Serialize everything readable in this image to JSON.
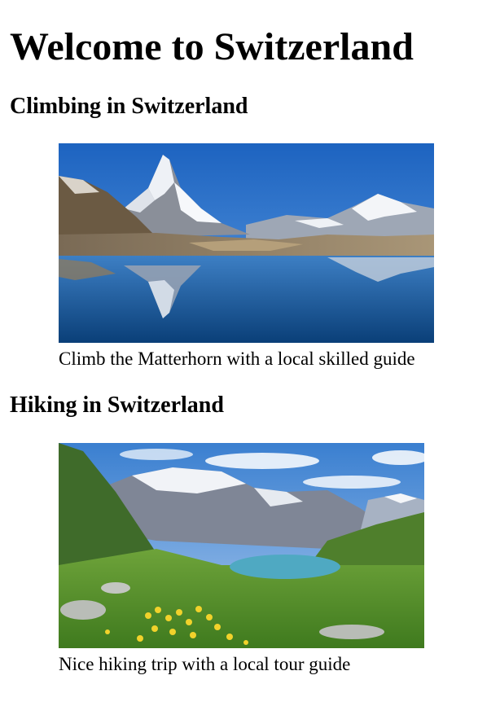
{
  "page": {
    "title": "Welcome to Switzerland"
  },
  "sections": [
    {
      "heading": "Climbing in Switzerland",
      "image_alt": "Matterhorn reflected in an alpine lake",
      "caption": "Climb the Matterhorn with a local skilled guide"
    },
    {
      "heading": "Hiking in Switzerland",
      "image_alt": "Alpine valley with a turquoise lake and yellow wildflowers",
      "caption": "Nice hiking trip with a local tour guide"
    }
  ],
  "colors": {
    "text": "#000000",
    "background": "#ffffff",
    "sky_blue": "#1f6fc6",
    "lake_blue": "#0d4f91",
    "meadow_green": "#5f9a2c",
    "turquoise_lake": "#4fa9c2"
  }
}
